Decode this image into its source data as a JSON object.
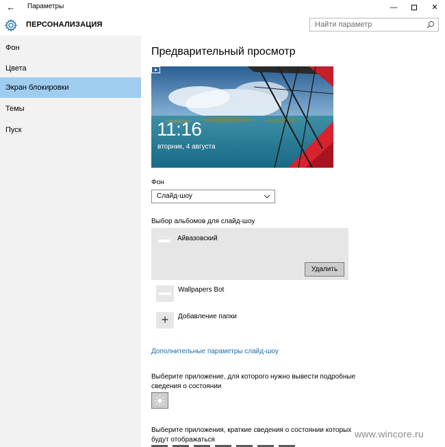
{
  "window": {
    "back_glyph": "←",
    "title": "Параметры",
    "minimize_glyph": "—",
    "close_glyph": "✕"
  },
  "header": {
    "section_title": "ПЕРСОНАЛИЗАЦИЯ",
    "icon": "gear-icon"
  },
  "search": {
    "placeholder": "Найти параметр",
    "icon": "search-icon"
  },
  "sidebar": {
    "items": [
      {
        "label": "Фон",
        "active": false
      },
      {
        "label": "Цвета",
        "active": false
      },
      {
        "label": "Экран блокировки",
        "active": true
      },
      {
        "label": "Темы",
        "active": false
      },
      {
        "label": "Пуск",
        "active": false
      }
    ]
  },
  "main": {
    "preview_heading": "Предварительный просмотр",
    "preview": {
      "time": "11:16",
      "date": "вторник, 4 августа"
    },
    "background_label": "Фон",
    "background_value": "Слайд-шоу",
    "albums_label": "Выбор альбомов для слайд-шоу",
    "albums": [
      {
        "name": "Айвазовский",
        "selected": true
      },
      {
        "name": "Wallpapers Bot",
        "selected": false
      }
    ],
    "delete_label": "Удалить",
    "add_folder_glyph": "+",
    "add_folder_label": "Добавление папки",
    "more_link": "Дополнительные параметры слайд-шоу",
    "detailed_app_text": "Выберите приложение, для которого нужно вывести подробные сведения о состоянии",
    "quick_apps_text": "Выберите приложения, краткие сведения о состоянии которых будут отображаться"
  },
  "watermark": "www.wincore.ru",
  "colors": {
    "sidebar_bg": "#f2f2f2",
    "active_item": "#9fcdf0",
    "link": "#1f6ba8",
    "album_card": "#e6e6e6"
  }
}
